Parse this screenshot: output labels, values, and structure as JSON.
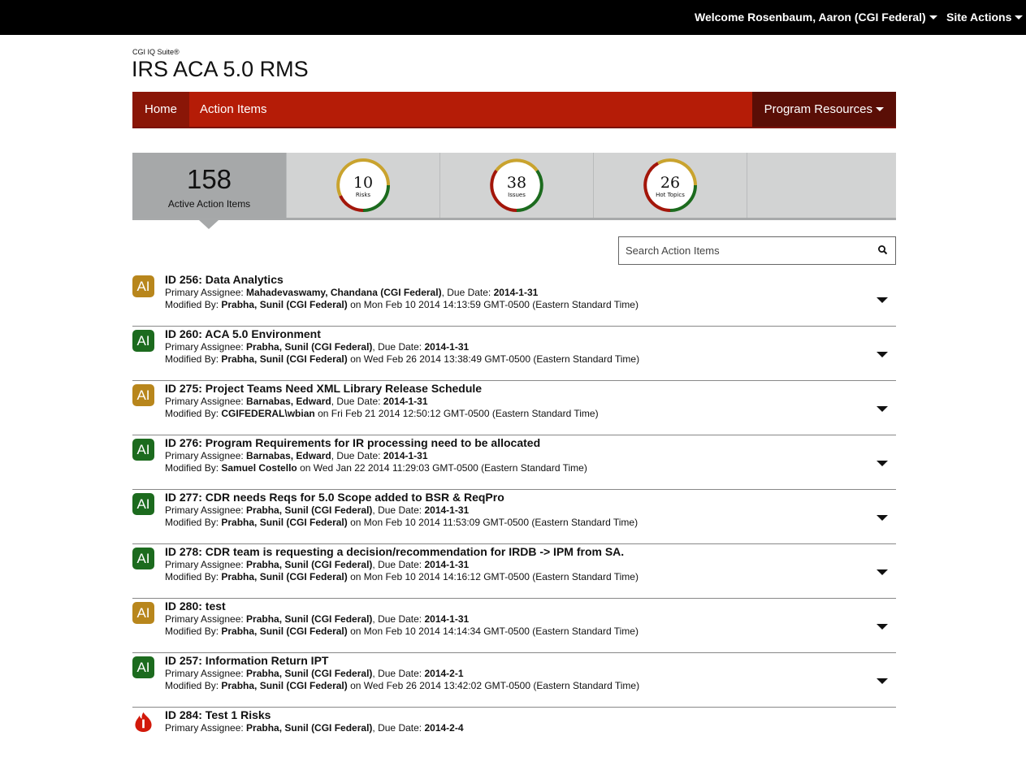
{
  "topbar": {
    "welcome": "Welcome Rosenbaum, Aaron (CGI Federal)",
    "site_actions": "Site Actions"
  },
  "header": {
    "suite": "CGI IQ Suite®",
    "title": "IRS ACA 5.0 RMS"
  },
  "nav": {
    "home": "Home",
    "action_items": "Action Items",
    "program_resources": "Program Resources"
  },
  "stats": {
    "main": {
      "count": "158",
      "label": "Active Action Items"
    },
    "risks": {
      "count": "10",
      "label": "Risks"
    },
    "issues": {
      "count": "38",
      "label": "Issues"
    },
    "hot_topics": {
      "count": "26",
      "label": "Hot Topics"
    }
  },
  "search": {
    "placeholder": "Search Action Items"
  },
  "colors": {
    "red": "#b51c07",
    "dark_red": "#8a1607",
    "green": "#1c6b1e",
    "gold": "#c9a32e"
  },
  "items": [
    {
      "badge": "AI",
      "color": "gold",
      "title": "ID 256: Data Analytics",
      "assignee_label": "Primary Assignee:",
      "assignee": "Mahadevaswamy, Chandana (CGI Federal)",
      "due_label": "Due Date:",
      "due": "2014-1-31",
      "mod_label": "Modified By:",
      "modified_by": "Prabha, Sunil (CGI Federal)",
      "modified_on": "on Mon Feb 10 2014 14:13:59 GMT-0500 (Eastern Standard Time)"
    },
    {
      "badge": "AI",
      "color": "green",
      "title": "ID 260: ACA 5.0 Environment",
      "assignee_label": "Primary Assignee:",
      "assignee": "Prabha, Sunil (CGI Federal)",
      "due_label": "Due Date:",
      "due": "2014-1-31",
      "mod_label": "Modified By:",
      "modified_by": "Prabha, Sunil (CGI Federal)",
      "modified_on": "on Wed Feb 26 2014 13:38:49 GMT-0500 (Eastern Standard Time)"
    },
    {
      "badge": "AI",
      "color": "gold",
      "title": "ID 275: Project Teams Need XML Library Release Schedule",
      "assignee_label": "Primary Assignee:",
      "assignee": "Barnabas, Edward",
      "due_label": "Due Date:",
      "due": "2014-1-31",
      "mod_label": "Modified By:",
      "modified_by": "CGIFEDERAL\\wbian",
      "modified_on": "on Fri Feb 21 2014 12:50:12 GMT-0500 (Eastern Standard Time)"
    },
    {
      "badge": "AI",
      "color": "green",
      "title": "ID 276: Program Requirements for IR processing need to be allocated",
      "assignee_label": "Primary Assignee:",
      "assignee": "Barnabas, Edward",
      "due_label": "Due Date:",
      "due": "2014-1-31",
      "mod_label": "Modified By:",
      "modified_by": "Samuel Costello",
      "modified_on": "on Wed Jan 22 2014 11:29:03 GMT-0500 (Eastern Standard Time)"
    },
    {
      "badge": "AI",
      "color": "green",
      "title": "ID 277: CDR needs Reqs for 5.0 Scope added to BSR & ReqPro",
      "assignee_label": "Primary Assignee:",
      "assignee": "Prabha, Sunil (CGI Federal)",
      "due_label": "Due Date:",
      "due": "2014-1-31",
      "mod_label": "Modified By:",
      "modified_by": "Prabha, Sunil (CGI Federal)",
      "modified_on": "on Mon Feb 10 2014 11:53:09 GMT-0500 (Eastern Standard Time)"
    },
    {
      "badge": "AI",
      "color": "green",
      "title": "ID 278: CDR team is requesting a decision/recommendation for IRDB -> IPM from SA.",
      "assignee_label": "Primary Assignee:",
      "assignee": "Prabha, Sunil (CGI Federal)",
      "due_label": "Due Date:",
      "due": "2014-1-31",
      "mod_label": "Modified By:",
      "modified_by": "Prabha, Sunil (CGI Federal)",
      "modified_on": "on Mon Feb 10 2014 14:16:12 GMT-0500 (Eastern Standard Time)"
    },
    {
      "badge": "AI",
      "color": "gold",
      "title": "ID 280: test",
      "assignee_label": "Primary Assignee:",
      "assignee": "Prabha, Sunil (CGI Federal)",
      "due_label": "Due Date:",
      "due": "2014-1-31",
      "mod_label": "Modified By:",
      "modified_by": "Prabha, Sunil (CGI Federal)",
      "modified_on": "on Mon Feb 10 2014 14:14:34 GMT-0500 (Eastern Standard Time)"
    },
    {
      "badge": "AI",
      "color": "green",
      "title": "ID 257: Information Return IPT",
      "assignee_label": "Primary Assignee:",
      "assignee": "Prabha, Sunil (CGI Federal)",
      "due_label": "Due Date:",
      "due": "2014-2-1",
      "mod_label": "Modified By:",
      "modified_by": "Prabha, Sunil (CGI Federal)",
      "modified_on": "on Wed Feb 26 2014 13:42:02 GMT-0500 (Eastern Standard Time)"
    },
    {
      "badge": "",
      "color": "fire",
      "title": "ID 284: Test 1 Risks",
      "assignee_label": "Primary Assignee:",
      "assignee": "Prabha, Sunil (CGI Federal)",
      "due_label": "Due Date:",
      "due": "2014-2-4",
      "mod_label": "",
      "modified_by": "",
      "modified_on": ""
    }
  ]
}
